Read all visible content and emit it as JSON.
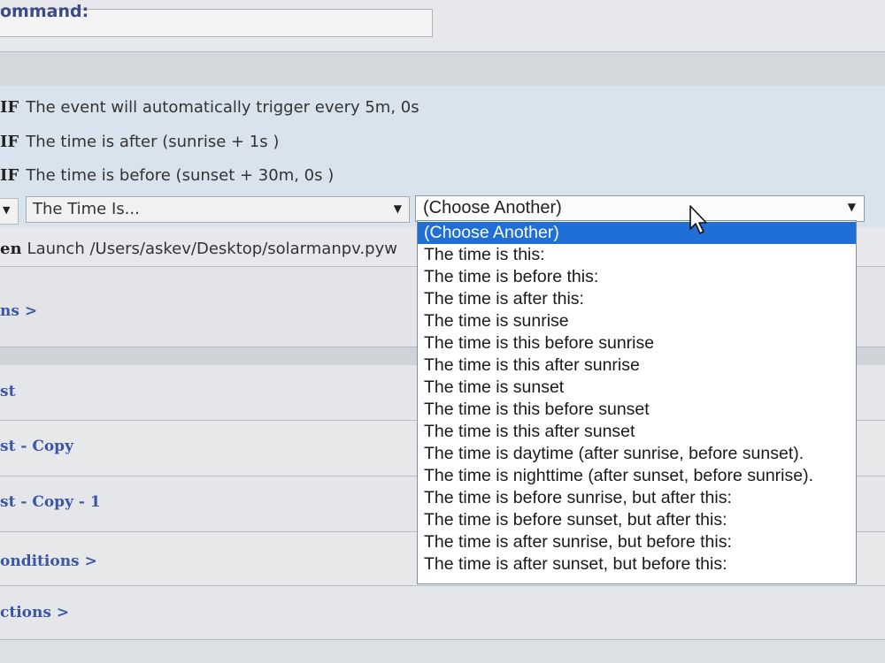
{
  "command": {
    "label": "ommand:",
    "value": ""
  },
  "conditions": [
    {
      "keyword": "IF",
      "text": "The event will automatically trigger every 5m, 0s"
    },
    {
      "keyword": "IF",
      "text": "The time is after (sunrise + 1s )"
    },
    {
      "keyword": "IF",
      "text": "The time is before (sunset + 30m, 0s )"
    }
  ],
  "new_condition": {
    "type_select": "The Time Is...",
    "value_select": "(Choose Another)",
    "options": [
      "(Choose Another)",
      "The time is this:",
      "The time is before this:",
      "The time is after this:",
      "The time is sunrise",
      "The time is this before sunrise",
      "The time is this after sunrise",
      "The time is sunset",
      "The time is this before sunset",
      "The time is this after sunset",
      "The time is daytime (after sunrise, before sunset).",
      "The time is nighttime (after sunset, before sunrise).",
      "The time is before sunrise, but after this:",
      "The time is before sunset, but after this:",
      "The time is after sunrise, but before this:",
      "The time is after sunset, but before this:"
    ],
    "selected_index": 0
  },
  "action": {
    "keyword": "en",
    "text": "Launch /Users/askev/Desktop/solarmanpv.pyw"
  },
  "links": {
    "actions_more": "ns >",
    "list_item_1": "st",
    "list_item_2": "st - Copy",
    "list_item_3": "st - Copy - 1",
    "conditions_more": "onditions >",
    "actions_more_2": "ctions >"
  },
  "colors": {
    "highlight": "#1f6fd6",
    "link": "#3b56a8",
    "background": "#dde0e4"
  }
}
